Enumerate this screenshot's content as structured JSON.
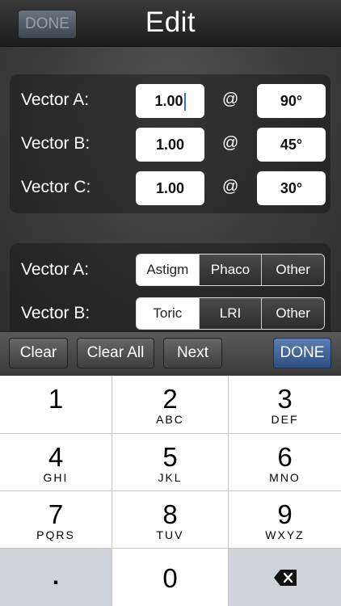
{
  "navbar": {
    "done_label": "DONE",
    "title": "Edit"
  },
  "vectors": [
    {
      "label": "Vector A:",
      "magnitude": "1.00",
      "at": "@",
      "angle": "90°"
    },
    {
      "label": "Vector B:",
      "magnitude": "1.00",
      "at": "@",
      "angle": "45°"
    },
    {
      "label": "Vector C:",
      "magnitude": "1.00",
      "at": "@",
      "angle": "30°"
    }
  ],
  "types": [
    {
      "label": "Vector A:",
      "options": [
        "Astigm",
        "Phaco",
        "Other"
      ],
      "selected": "Astigm"
    },
    {
      "label": "Vector B:",
      "options": [
        "Toric",
        "LRI",
        "Other"
      ],
      "selected": "Toric"
    }
  ],
  "toolbar": {
    "clear": "Clear",
    "clear_all": "Clear All",
    "next": "Next",
    "done": "DONE"
  },
  "keypad": {
    "keys": [
      {
        "num": "1",
        "letters": ""
      },
      {
        "num": "2",
        "letters": "ABC"
      },
      {
        "num": "3",
        "letters": "DEF"
      },
      {
        "num": "4",
        "letters": "GHI"
      },
      {
        "num": "5",
        "letters": "JKL"
      },
      {
        "num": "6",
        "letters": "MNO"
      },
      {
        "num": "7",
        "letters": "PQRS"
      },
      {
        "num": "8",
        "letters": "TUV"
      },
      {
        "num": "9",
        "letters": "WXYZ"
      }
    ],
    "dot": ".",
    "zero": "0",
    "backspace_icon": "backspace-icon"
  }
}
